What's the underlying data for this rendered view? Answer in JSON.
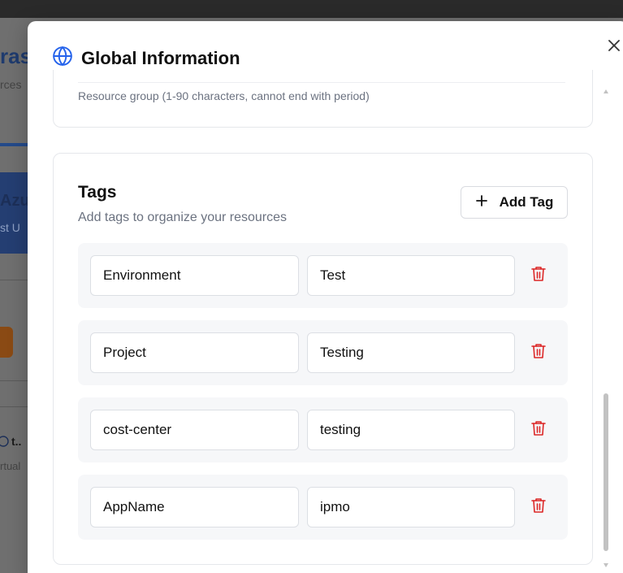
{
  "background": {
    "title_fragment": "ras",
    "subtitle_fragment": "rces",
    "card_title_fragment": "Azu",
    "card_sub_fragment": "st U",
    "item_fragment": "t..",
    "item_sub_fragment": "rtual"
  },
  "modal": {
    "title": "Global Information",
    "icon": "globe-icon",
    "close_icon": "close-icon"
  },
  "resource_group": {
    "hint": "Resource group (1-90 characters, cannot end with period)"
  },
  "tags": {
    "title": "Tags",
    "description": "Add tags to organize your resources",
    "add_label": "Add Tag",
    "rows": [
      {
        "key": "Environment",
        "value": "Test"
      },
      {
        "key": "Project",
        "value": "Testing"
      },
      {
        "key": "cost-center",
        "value": "testing"
      },
      {
        "key": "AppName",
        "value": "ipmo"
      }
    ]
  },
  "colors": {
    "accent": "#2563eb",
    "delete": "#dc2626",
    "row_bg": "#f6f7f9"
  }
}
